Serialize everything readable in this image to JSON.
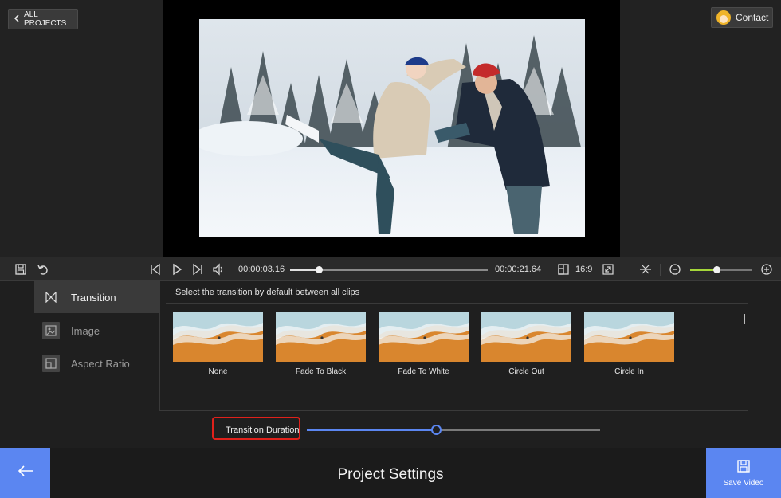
{
  "header": {
    "all_projects_label": "ALL PROJECTS",
    "contact_label": "Contact"
  },
  "player": {
    "current_time": "00:00:03.16",
    "total_time": "00:00:21.64",
    "progress": 0.146,
    "aspect_ratio": "16:9",
    "zoom_level": 0.42,
    "icons": [
      "save-icon",
      "undo-icon",
      "skip-back-icon",
      "play-icon",
      "skip-forward-icon",
      "volume-icon",
      "aspect-ratio-icon",
      "fullscreen-icon",
      "split-icon",
      "zoom-out-icon",
      "zoom-in-icon"
    ]
  },
  "sidebar": {
    "items": [
      {
        "label": "Transition",
        "icon": "transition-icon",
        "active": true
      },
      {
        "label": "Image",
        "icon": "image-icon",
        "active": false
      },
      {
        "label": "Aspect Ratio",
        "icon": "aspect-ratio-icon",
        "active": false
      }
    ]
  },
  "panel": {
    "heading": "Select the transition by default between all clips",
    "transitions": [
      {
        "label": "None"
      },
      {
        "label": "Fade To Black"
      },
      {
        "label": "Fade To White"
      },
      {
        "label": "Circle Out"
      },
      {
        "label": "Circle In"
      }
    ],
    "duration_label": "Transition Duration",
    "duration_value": 0.44
  },
  "footer": {
    "title": "Project Settings",
    "save_label": "Save Video"
  },
  "colors": {
    "accent": "#5b86f1",
    "highlight_box": "#e0211b",
    "zoom_fill": "#a5d63a"
  }
}
